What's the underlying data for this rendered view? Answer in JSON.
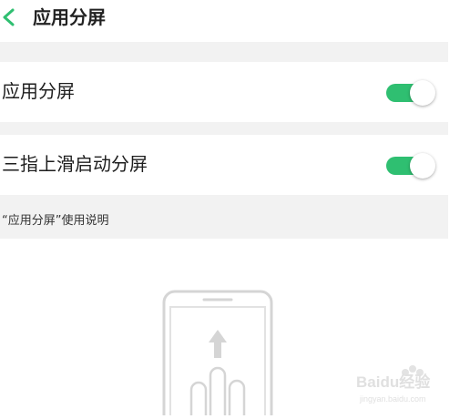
{
  "header": {
    "back_icon": "chevron-left-icon",
    "title": "应用分屏"
  },
  "settings": [
    {
      "label": "应用分屏",
      "enabled": true
    },
    {
      "label": "三指上滑启动分屏",
      "enabled": true
    }
  ],
  "help": {
    "text": "“应用分屏”使用说明"
  },
  "illustration": {
    "icons": [
      "phone-outline-icon",
      "arrow-up-icon",
      "three-finger-hand-icon"
    ]
  },
  "watermark": {
    "brand": "Baidu经验",
    "url": "jingyan.baidu.com"
  },
  "colors": {
    "accent": "#2fbf71",
    "section_gap": "#f2f2f2",
    "illustration_stroke": "#d5d5d5"
  }
}
